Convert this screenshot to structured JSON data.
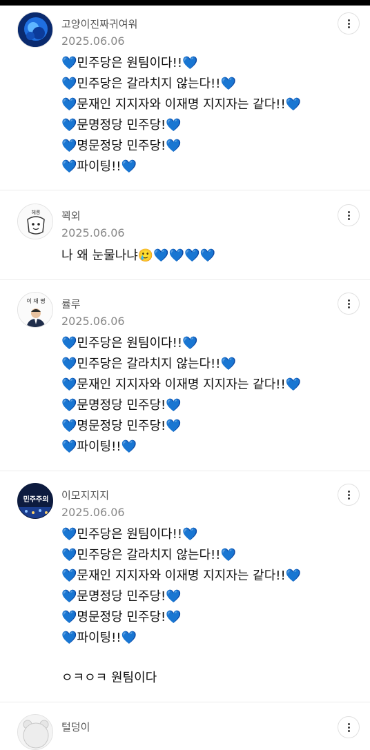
{
  "comments": [
    {
      "username": "고양이진짜귀여워",
      "date": "2025.06.06",
      "lines": [
        "💙민주당은 원팀이다!!💙",
        "💙민주당은 갈라치지 않는다!!💙",
        "💙문재인 지지자와 이재명 지지자는 같다!!💙",
        "💙문명정당 민주당!💙",
        "💙명문정당 민주당!💙",
        "💙파이팅!!💙"
      ]
    },
    {
      "username": "꾁외",
      "date": "2025.06.06",
      "avatar_text": "헤롱",
      "lines": [
        "나 왜 눈물나냐🥲💙💙💙💙"
      ]
    },
    {
      "username": "률루",
      "date": "2025.06.06",
      "avatar_text": "이 재 명",
      "lines": [
        "💙민주당은 원팀이다!!💙",
        "💙민주당은 갈라치지 않는다!!💙",
        "💙문재인 지지자와 이재명 지지자는 같다!!💙",
        "💙문명정당 민주당!💙",
        "💙명문정당 민주당!💙",
        "💙파이팅!!💙"
      ]
    },
    {
      "username": "이모지지지",
      "date": "2025.06.06",
      "avatar_text": "민주주의",
      "lines": [
        "💙민주당은 원팀이다!!💙",
        "💙민주당은 갈라치지 않는다!!💙",
        "💙문재인 지지자와 이재명 지지자는 같다!!💙",
        "💙문명정당 민주당!💙",
        "💙명문정당 민주당!💙",
        "💙파이팅!!💙",
        "",
        "ㅇㅋㅇㅋ 원팀이다"
      ]
    },
    {
      "username": "털덩이",
      "date": "",
      "lines": []
    }
  ],
  "icons": {
    "more": "more-vertical-icon"
  }
}
